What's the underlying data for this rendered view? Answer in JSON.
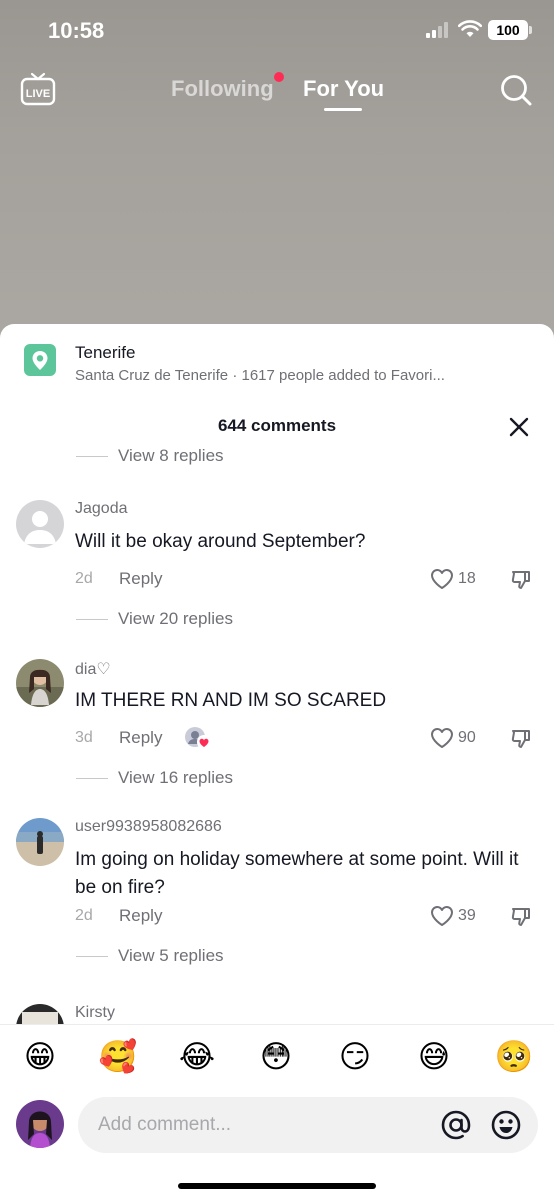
{
  "status_bar": {
    "time": "10:58",
    "battery": "100"
  },
  "top_nav": {
    "following_label": "Following",
    "for_you_label": "For You",
    "live_label": "LIVE"
  },
  "location": {
    "title": "Tenerife",
    "subtitle": "Santa Cruz de Tenerife · 1617 people added to Favori..."
  },
  "comments_header": {
    "title": "644 comments"
  },
  "comments": {
    "prev_view_replies": "View 8 replies",
    "items": [
      {
        "username": "Jagoda",
        "text": "Will it be okay around September?",
        "date": "2d",
        "reply_label": "Reply",
        "likes": "18",
        "view_replies": "View 20 replies"
      },
      {
        "username": "dia♡",
        "text": "IM THERE RN AND IM SO SCARED",
        "date": "3d",
        "reply_label": "Reply",
        "likes": "90",
        "view_replies": "View 16 replies"
      },
      {
        "username": "user9938958082686",
        "text": "Im going on holiday somewhere at some point. Will it be on fire?",
        "date": "2d",
        "reply_label": "Reply",
        "likes": "39",
        "view_replies": "View 5 replies"
      },
      {
        "username": "Kirsty"
      }
    ]
  },
  "emoji_bar": {
    "emojis": [
      "😁",
      "🥰",
      "😂",
      "😳",
      "😏",
      "😅",
      "🥺"
    ]
  },
  "composer": {
    "placeholder": "Add comment..."
  },
  "colors": {
    "accent": "#fe2c55",
    "location_icon": "#5dc59a",
    "text_primary": "#161823",
    "text_secondary": "#6f7076"
  }
}
